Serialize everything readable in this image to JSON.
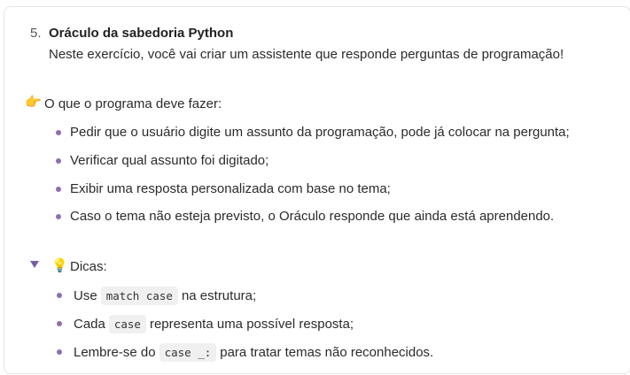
{
  "exercise": {
    "number": "5.",
    "title": "Oráculo da sabedoria Python",
    "description": "Neste exercício, você vai criar um assistente que responde perguntas de programação!"
  },
  "task_section": {
    "icon": "pointing-hand-icon",
    "icon_glyph": "👉",
    "heading": "O que o programa deve fazer:",
    "items": [
      "Pedir que o usuário digite um assunto da programação, pode já colocar na pergunta;",
      "Verificar qual assunto foi digitado;",
      "Exibir uma resposta personalizada com base no tema;",
      "Caso o tema não esteja previsto, o Oráculo responde que ainda está aprendendo."
    ]
  },
  "tips": {
    "toggle_icon": "caret-down-icon",
    "icon": "lightbulb-icon",
    "icon_glyph": "💡",
    "heading": "Dicas:",
    "items": [
      {
        "before": "Use",
        "code": "match case",
        "after": "na estrutura;"
      },
      {
        "before": "Cada",
        "code": "case",
        "after": "representa uma possível resposta;"
      },
      {
        "before": "Lembre-se do",
        "code": "case _:",
        "after": "para tratar temas não reconhecidos."
      }
    ]
  },
  "colors": {
    "bullet": "#8e6fb0",
    "toggle": "#7a5ca6",
    "code_bg": "#f0f0f0"
  }
}
